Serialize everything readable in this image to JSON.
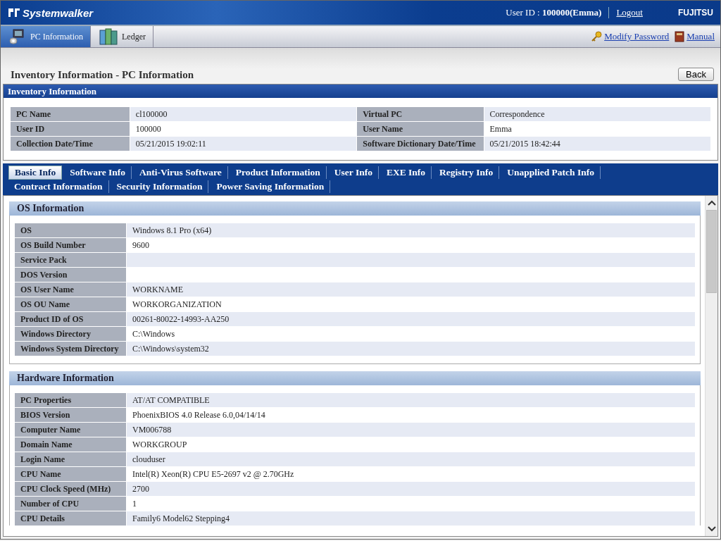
{
  "header": {
    "logo": "Systemwalker",
    "user_label": "User ID : ",
    "user_value": "100000(Emma)",
    "logout": "Logout",
    "brand": "FUJITSU"
  },
  "nav": {
    "tabs": [
      {
        "label": "PC Information",
        "selected": true
      },
      {
        "label": "Ledger",
        "selected": false
      }
    ],
    "links": [
      {
        "label": "Modify Password"
      },
      {
        "label": "Manual"
      }
    ]
  },
  "page_title": "Inventory Information - PC Information",
  "back_button": "Back",
  "inventory": {
    "title": "Inventory Information",
    "rows": [
      {
        "cells": [
          {
            "label": "PC Name",
            "value": "cl100000"
          },
          {
            "label": "Virtual PC",
            "value": "Correspondence"
          }
        ]
      },
      {
        "cells": [
          {
            "label": "User ID",
            "value": "100000"
          },
          {
            "label": "User Name",
            "value": "Emma"
          }
        ]
      },
      {
        "cells": [
          {
            "label": "Collection Date/Time",
            "value": "05/21/2015 19:02:11"
          },
          {
            "label": "Software Dictionary Date/Time",
            "value": "05/21/2015 18:42:44"
          }
        ]
      }
    ]
  },
  "tabs": [
    [
      {
        "label": "Basic Info",
        "selected": true
      },
      {
        "label": "Software Info",
        "selected": false
      },
      {
        "label": "Anti-Virus Software",
        "selected": false
      },
      {
        "label": "Product Information",
        "selected": false
      },
      {
        "label": "User Info",
        "selected": false
      },
      {
        "label": "EXE Info",
        "selected": false
      },
      {
        "label": "Registry Info",
        "selected": false
      },
      {
        "label": "Unapplied Patch Info",
        "selected": false
      }
    ],
    [
      {
        "label": "Contract Information",
        "selected": false
      },
      {
        "label": "Security Information",
        "selected": false
      },
      {
        "label": "Power Saving Information",
        "selected": false
      }
    ]
  ],
  "sections": [
    {
      "title": "OS Information",
      "rows": [
        {
          "label": "OS",
          "value": "Windows 8.1 Pro (x64)"
        },
        {
          "label": "OS Build Number",
          "value": "9600"
        },
        {
          "label": "Service Pack",
          "value": ""
        },
        {
          "label": "DOS Version",
          "value": ""
        },
        {
          "label": "OS User Name",
          "value": "WORKNAME"
        },
        {
          "label": "OS OU Name",
          "value": "WORKORGANIZATION"
        },
        {
          "label": "Product ID of OS",
          "value": "00261-80022-14993-AA250"
        },
        {
          "label": "Windows Directory",
          "value": "C:\\Windows"
        },
        {
          "label": "Windows System Directory",
          "value": "C:\\Windows\\system32"
        }
      ]
    },
    {
      "title": "Hardware Information",
      "rows": [
        {
          "label": "PC Properties",
          "value": "AT/AT COMPATIBLE"
        },
        {
          "label": "BIOS Version",
          "value": "PhoenixBIOS 4.0 Release 6.0,04/14/14"
        },
        {
          "label": "Computer Name",
          "value": "VM006788"
        },
        {
          "label": "Domain Name",
          "value": "WORKGROUP"
        },
        {
          "label": "Login Name",
          "value": "clouduser"
        },
        {
          "label": "CPU Name",
          "value": "Intel(R) Xeon(R) CPU E5-2697 v2 @ 2.70GHz"
        },
        {
          "label": "CPU Clock Speed (MHz)",
          "value": "2700"
        },
        {
          "label": "Number of CPU",
          "value": "1"
        },
        {
          "label": "CPU Details",
          "value": "Family6 Model62 Stepping4"
        }
      ]
    }
  ]
}
